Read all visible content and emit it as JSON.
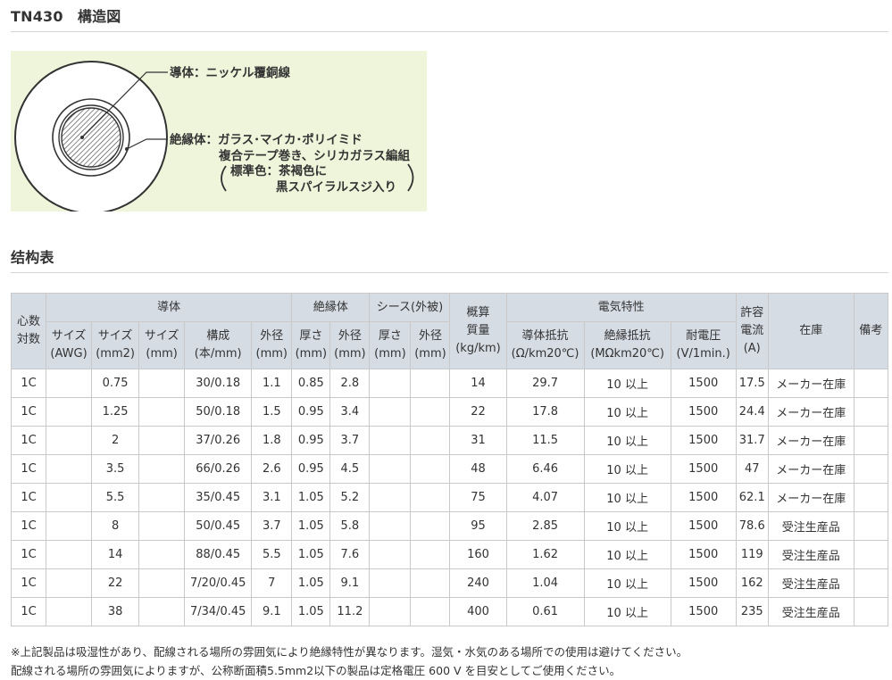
{
  "section1": {
    "title": "TN430　構造図"
  },
  "diagram": {
    "conductor": "導体：ニッケル覆銅線",
    "insulation_line1": "絶縁体：ガラス･マイカ･ポリイミド",
    "insulation_line2": "複合テープ巻き、シリカガラス編組",
    "color_line1": "標準色：茶褐色に",
    "color_line2": "黒スパイラルスジ入り",
    "colors": {
      "background": "#eef5da",
      "line": "#333333"
    }
  },
  "section2": {
    "title": "结构表"
  },
  "table": {
    "header": {
      "core": [
        "心数",
        "対数"
      ],
      "conductor": "導体",
      "insulation": "絶縁体",
      "sheath": "シース(外被)",
      "weight": [
        "概算",
        "質量",
        "(kg/km)"
      ],
      "electrical": "電気特性",
      "current": [
        "許容",
        "電流",
        "(A)"
      ],
      "stock": "在庫",
      "remarks": "備考",
      "awg": [
        "サイズ",
        "(AWG)"
      ],
      "size_mm2": [
        "サイズ",
        "(mm2)"
      ],
      "size_mm": [
        "サイズ",
        "(mm)"
      ],
      "strand": [
        "構成",
        "(本/mm)"
      ],
      "cond_od": [
        "外径",
        "(mm)"
      ],
      "ins_thick": [
        "厚さ",
        "(mm)"
      ],
      "ins_od": [
        "外径",
        "(mm)"
      ],
      "sh_thick": [
        "厚さ",
        "(mm)"
      ],
      "sh_od": [
        "外径",
        "(mm)"
      ],
      "resistance": [
        "導体抵抗",
        "(Ω/km20℃)"
      ],
      "ins_resistance": [
        "絶縁抵抗",
        "(MΩkm20℃)"
      ],
      "voltage": [
        "耐電圧",
        "(V/1min.)"
      ]
    },
    "rows": [
      [
        "1C",
        "",
        "0.75",
        "",
        "30/0.18",
        "1.1",
        "0.85",
        "2.8",
        "",
        "",
        "14",
        "29.7",
        "10 以上",
        "1500",
        "17.5",
        "メーカー在庫",
        ""
      ],
      [
        "1C",
        "",
        "1.25",
        "",
        "50/0.18",
        "1.5",
        "0.95",
        "3.4",
        "",
        "",
        "22",
        "17.8",
        "10 以上",
        "1500",
        "24.4",
        "メーカー在庫",
        ""
      ],
      [
        "1C",
        "",
        "2",
        "",
        "37/0.26",
        "1.8",
        "0.95",
        "3.7",
        "",
        "",
        "31",
        "11.5",
        "10 以上",
        "1500",
        "31.7",
        "メーカー在庫",
        ""
      ],
      [
        "1C",
        "",
        "3.5",
        "",
        "66/0.26",
        "2.6",
        "0.95",
        "4.5",
        "",
        "",
        "48",
        "6.46",
        "10 以上",
        "1500",
        "47",
        "メーカー在庫",
        ""
      ],
      [
        "1C",
        "",
        "5.5",
        "",
        "35/0.45",
        "3.1",
        "1.05",
        "5.2",
        "",
        "",
        "75",
        "4.07",
        "10 以上",
        "1500",
        "62.1",
        "メーカー在庫",
        ""
      ],
      [
        "1C",
        "",
        "8",
        "",
        "50/0.45",
        "3.7",
        "1.05",
        "5.8",
        "",
        "",
        "95",
        "2.85",
        "10 以上",
        "1500",
        "78.6",
        "受注生産品",
        ""
      ],
      [
        "1C",
        "",
        "14",
        "",
        "88/0.45",
        "5.5",
        "1.05",
        "7.6",
        "",
        "",
        "160",
        "1.62",
        "10 以上",
        "1500",
        "119",
        "受注生産品",
        ""
      ],
      [
        "1C",
        "",
        "22",
        "",
        "7/20/0.45",
        "7",
        "1.05",
        "9.1",
        "",
        "",
        "240",
        "1.04",
        "10 以上",
        "1500",
        "162",
        "受注生産品",
        ""
      ],
      [
        "1C",
        "",
        "38",
        "",
        "7/34/0.45",
        "9.1",
        "1.05",
        "11.2",
        "",
        "",
        "400",
        "0.61",
        "10 以上",
        "1500",
        "235",
        "受注生産品",
        ""
      ]
    ],
    "colors": {
      "header_bg": "#d6dce4",
      "border": "#c9c9c9"
    }
  },
  "notes": {
    "line1": "※上記製品は吸湿性があり、配線される場所の雰囲気により絶縁特性が異なります。湿気・水気のある場所での使用は避けてください。",
    "line2": "配線される場所の雰囲気によりますが、公称断面積5.5mm2以下の製品は定格電圧 600 V を目安としてご使用ください。"
  }
}
